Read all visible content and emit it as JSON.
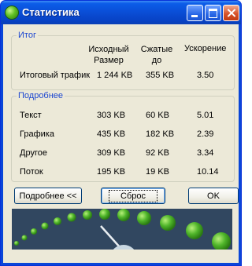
{
  "window": {
    "title": "Статистика"
  },
  "summary": {
    "legend": "Итог",
    "col_original": "Исходный\nРазмер",
    "col_compressed": "Сжатые\nдо",
    "col_speedup": "Ускорение",
    "row_label": "Итоговый трафик",
    "original": "1 244 KB",
    "compressed": "355 KB",
    "speedup": "3.50"
  },
  "details": {
    "legend": "Подробнее",
    "rows": [
      {
        "label": "Текст",
        "original": "303 KB",
        "compressed": "60 KB",
        "speedup": "5.01"
      },
      {
        "label": "Графика",
        "original": "435 KB",
        "compressed": "182 KB",
        "speedup": "2.39"
      },
      {
        "label": "Другое",
        "original": "309 KB",
        "compressed": "92 KB",
        "speedup": "3.34"
      },
      {
        "label": "Поток",
        "original": "195 KB",
        "compressed": "19 KB",
        "speedup": "10.14"
      }
    ]
  },
  "buttons": {
    "details": "Подробнее <<",
    "reset": "Сброс",
    "ok": "OK"
  },
  "colors": {
    "title_bar": "#0a4fd8",
    "legend_text": "#1c46d0",
    "banner_bg": "#314760",
    "dot_green": "#4fb52a"
  }
}
